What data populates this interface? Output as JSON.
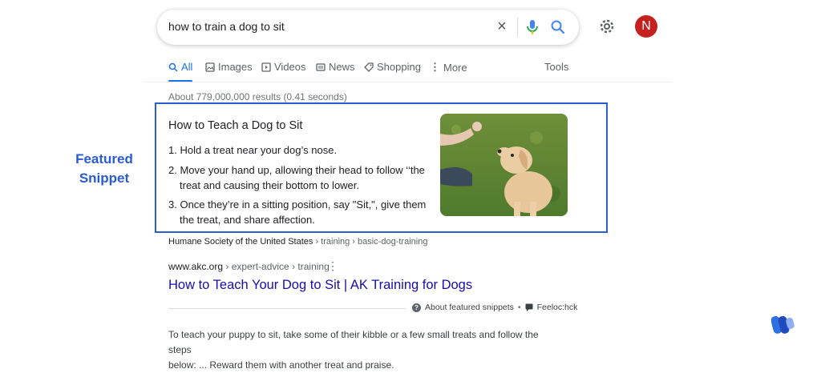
{
  "search": {
    "query": "how to train a dog to sit"
  },
  "profile": {
    "initial": "N",
    "color": "#c5221f"
  },
  "tabs": [
    {
      "label": "All",
      "icon": "search-icon",
      "active": true
    },
    {
      "label": "Images",
      "icon": "image-icon"
    },
    {
      "label": "Videos",
      "icon": "video-icon"
    },
    {
      "label": "News",
      "icon": "news-icon"
    },
    {
      "label": "Shopping",
      "icon": "tag-icon"
    },
    {
      "label": "More",
      "icon": "more-vert-icon"
    },
    {
      "label": "Tools"
    }
  ],
  "results_stats": "About 779,000,000 results (0.41 seconds)",
  "side_label": {
    "line1": "Featured",
    "line2": "Snippet",
    "color": "#2a5bd7"
  },
  "snippet": {
    "title": "How to Teach a Dog to Sit",
    "steps": [
      {
        "line1": "1. Hold a treat near your dog’s nose."
      },
      {
        "line1": "2. Move your hand up, allowing their head to follow ‘‘the",
        "line2": "treat and causing their bottom to lower."
      },
      {
        "line1": "3. Once they’re in a sitting position, say \"Sit,\", give them",
        "line2": "the treat, and share affection."
      }
    ],
    "image_icon": "dog-photo",
    "border_color": "#2b5fd0"
  },
  "source": {
    "site": "Humane Society of the United States",
    "path": " › training › basic-dog-training"
  },
  "result": {
    "domain": "www.akc.org",
    "path": " › expert-advice › training",
    "title": "How to Teach Your Dog to Sit | AK  Training for Dogs",
    "link_color": "#1a0dab"
  },
  "about": {
    "about_label": "About featured snippets",
    "separator": "•",
    "feedback_label": "Feeloc:hck"
  },
  "description": {
    "line1": "To teach your puppy to sit, take some of their kibble or a few small treats and follow the steps",
    "line2": "below: ... Reward them with another treat and praise."
  },
  "accent": "#1a73e8"
}
